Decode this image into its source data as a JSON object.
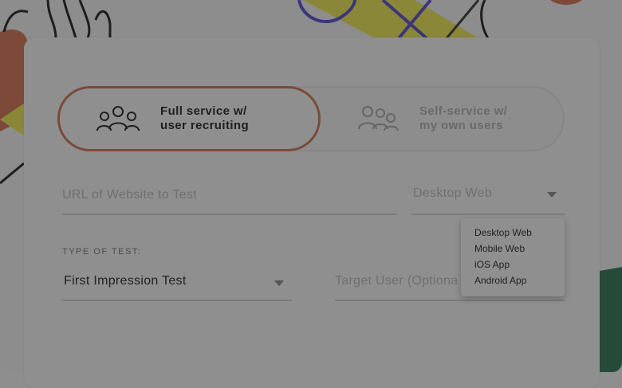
{
  "service_toggle": {
    "full_service_label": "Full service w/ user recruiting",
    "self_service_label": "Self-service w/ my own users"
  },
  "url_field": {
    "placeholder": "URL of Website to Test"
  },
  "platform_select": {
    "value": "Desktop Web"
  },
  "platform_dropdown": {
    "options": [
      "Desktop Web",
      "Mobile Web",
      "iOS App",
      "Android App"
    ]
  },
  "test_type": {
    "section_label": "TYPE OF TEST:",
    "value": "First Impression Test"
  },
  "target_user_field": {
    "placeholder": "Target User (Optiona"
  },
  "icons": {
    "full_service": "people-group-icon",
    "self_service": "people-group-icon"
  }
}
